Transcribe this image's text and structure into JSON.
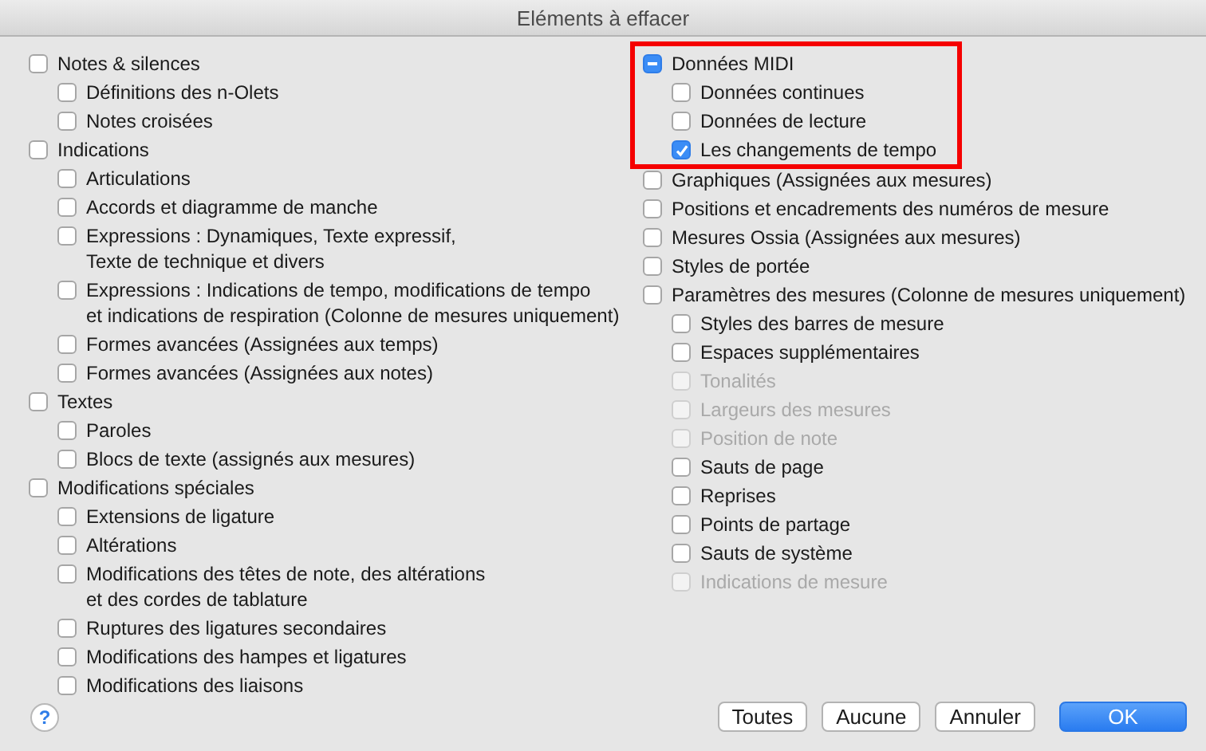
{
  "window": {
    "title": "Eléments à effacer"
  },
  "columns": [
    {
      "items": [
        {
          "label": "Notes & silences",
          "checked": false,
          "children": [
            {
              "label": "Définitions des n-Olets",
              "checked": false
            },
            {
              "label": "Notes croisées",
              "checked": false
            }
          ]
        },
        {
          "label": "Indications",
          "checked": false,
          "children": [
            {
              "label": "Articulations",
              "checked": false
            },
            {
              "label": "Accords et diagramme de manche",
              "checked": false
            },
            {
              "label": "Expressions : Dynamiques, Texte expressif,\nTexte de technique et divers",
              "checked": false
            },
            {
              "label": "Expressions : Indications de tempo, modifications de tempo\net indications de respiration (Colonne de mesures uniquement)",
              "checked": false
            },
            {
              "label": "Formes avancées (Assignées aux temps)",
              "checked": false
            },
            {
              "label": "Formes avancées (Assignées aux notes)",
              "checked": false
            }
          ]
        },
        {
          "label": "Textes",
          "checked": false,
          "children": [
            {
              "label": "Paroles",
              "checked": false
            },
            {
              "label": "Blocs de texte (assignés aux mesures)",
              "checked": false
            }
          ]
        },
        {
          "label": "Modifications spéciales",
          "checked": false,
          "children": [
            {
              "label": "Extensions de ligature",
              "checked": false
            },
            {
              "label": "Altérations",
              "checked": false
            },
            {
              "label": "Modifications des têtes de note, des altérations\net des cordes de tablature",
              "checked": false
            },
            {
              "label": "Ruptures des ligatures secondaires",
              "checked": false
            },
            {
              "label": "Modifications des hampes et ligatures",
              "checked": false
            },
            {
              "label": "Modifications des liaisons",
              "checked": false
            }
          ]
        }
      ]
    },
    {
      "items": [
        {
          "label": "Données MIDI",
          "mixed": true,
          "highlighted": true,
          "children": [
            {
              "label": "Données continues",
              "checked": false
            },
            {
              "label": "Données de lecture",
              "checked": false
            },
            {
              "label": "Les changements de tempo",
              "checked": true
            }
          ]
        },
        {
          "label": "Graphiques (Assignées aux mesures)",
          "checked": false
        },
        {
          "label": "Positions et encadrements des numéros de mesure",
          "checked": false
        },
        {
          "label": "Mesures Ossia (Assignées aux mesures)",
          "checked": false
        },
        {
          "label": "Styles de portée",
          "checked": false
        },
        {
          "label": "Paramètres des mesures (Colonne de mesures uniquement)",
          "checked": false,
          "children": [
            {
              "label": "Styles des barres de mesure",
              "checked": false
            },
            {
              "label": "Espaces supplémentaires",
              "checked": false
            },
            {
              "label": "Tonalités",
              "checked": false,
              "disabled": true
            },
            {
              "label": "Largeurs des mesures",
              "checked": false,
              "disabled": true
            },
            {
              "label": "Position de note",
              "checked": false,
              "disabled": true
            },
            {
              "label": "Sauts de page",
              "checked": false
            },
            {
              "label": "Reprises",
              "checked": false
            },
            {
              "label": "Points de partage",
              "checked": false
            },
            {
              "label": "Sauts de système",
              "checked": false
            },
            {
              "label": "Indications de mesure",
              "checked": false,
              "disabled": true
            }
          ]
        }
      ]
    }
  ],
  "footer": {
    "help": "?",
    "buttons": [
      {
        "label": "Toutes",
        "primary": false
      },
      {
        "label": "Aucune",
        "primary": false
      },
      {
        "label": "Annuler",
        "primary": false
      },
      {
        "label": "OK",
        "primary": true
      }
    ]
  }
}
